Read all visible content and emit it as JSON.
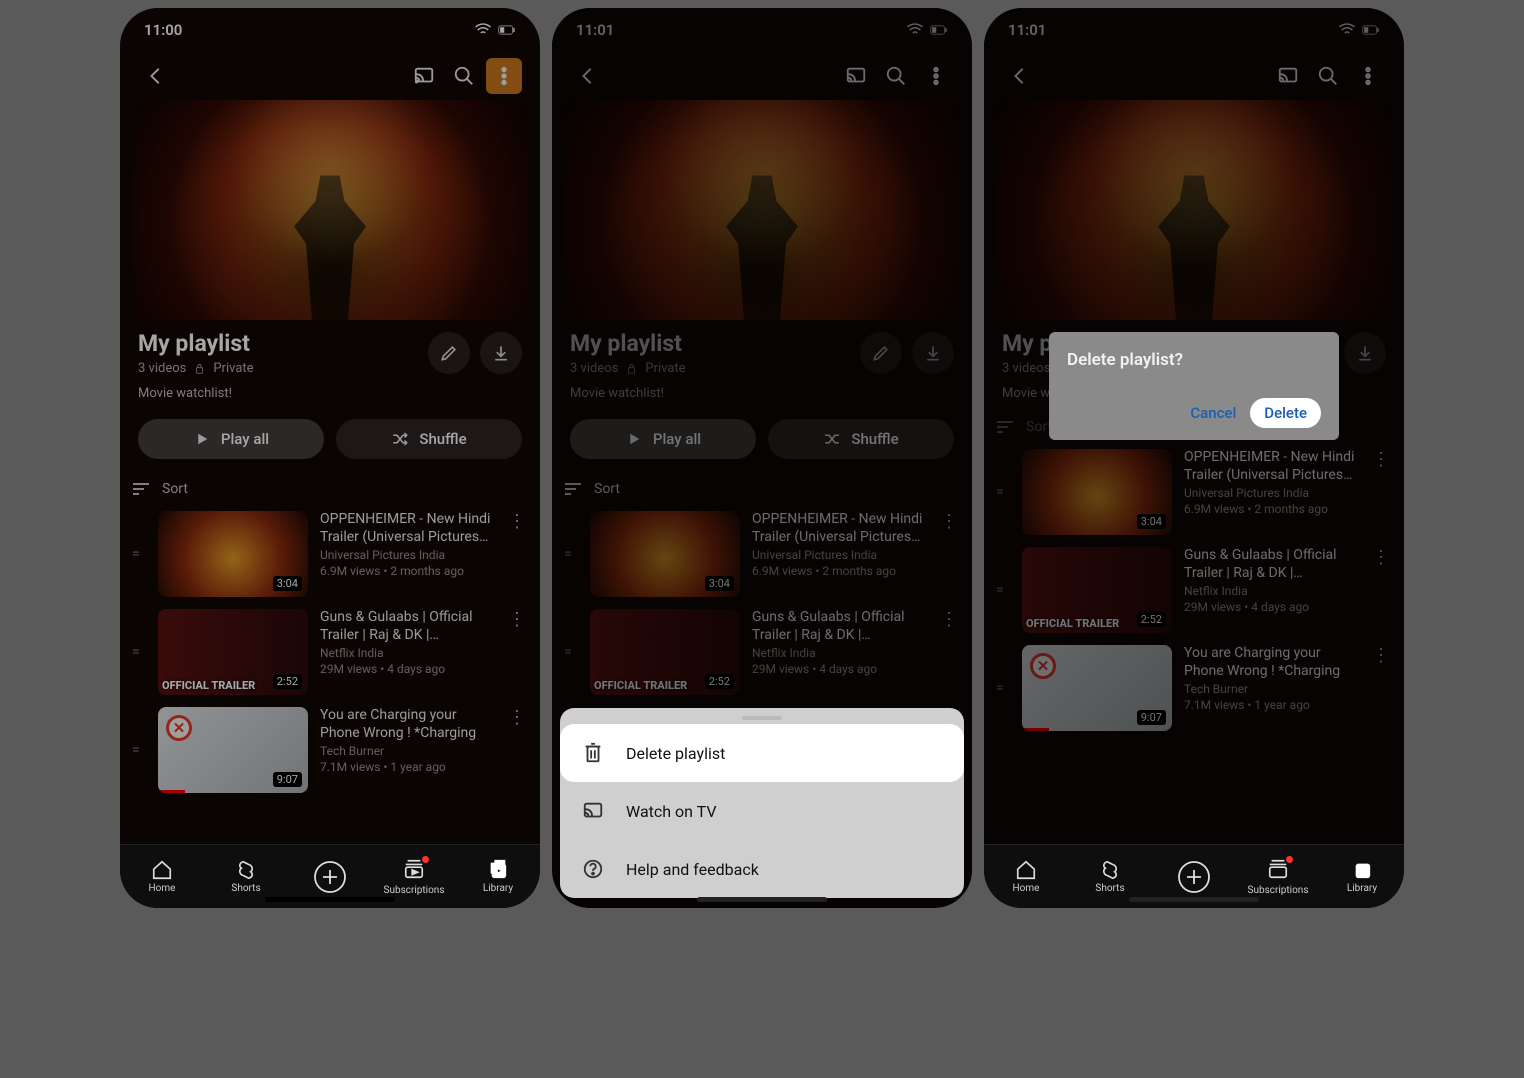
{
  "status": {
    "time1": "11:00",
    "time2": "11:01",
    "time3": "11:01"
  },
  "playlist": {
    "title": "My playlist",
    "count": "3 videos",
    "privacy": "Private",
    "description": "Movie watchlist!",
    "play_all": "Play all",
    "shuffle": "Shuffle",
    "sort": "Sort"
  },
  "videos": [
    {
      "title": "OPPENHEIMER - New Hindi Trailer (Universal Pictures…",
      "channel": "Universal Pictures India",
      "stats": "6.9M views • 2 months ago",
      "duration": "3:04"
    },
    {
      "title": "Guns & Gulaabs | Official Trailer | Raj & DK |…",
      "channel": "Netflix India",
      "stats": "29M views • 4 days ago",
      "duration": "2:52",
      "overlay": "OFFICIAL\nTRAILER"
    },
    {
      "title": "You are Charging your Phone Wrong ! *Charging Tricks*",
      "channel": "Tech Burner",
      "stats": "7.1M views • 1 year ago",
      "duration": "9:07"
    }
  ],
  "nav": {
    "home": "Home",
    "shorts": "Shorts",
    "subs": "Subscriptions",
    "library": "Library"
  },
  "sheet": {
    "delete": "Delete playlist",
    "watch_tv": "Watch on TV",
    "help": "Help and feedback"
  },
  "dialog": {
    "title": "Delete playlist?",
    "cancel": "Cancel",
    "delete": "Delete"
  }
}
